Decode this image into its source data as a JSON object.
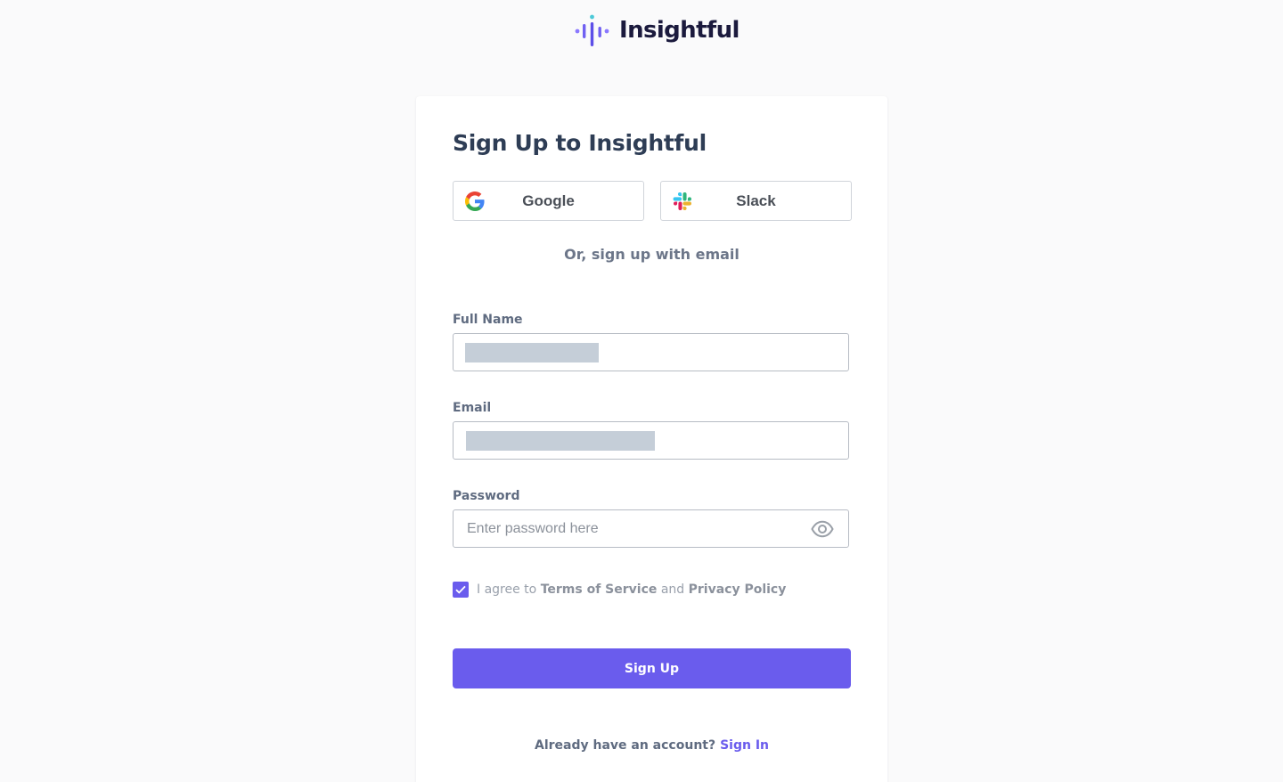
{
  "brand": {
    "name": "Insightful",
    "accent": "#6a5ced",
    "logo_icon": "audio-wave-logo"
  },
  "signup": {
    "title": "Sign Up to Insightful",
    "social": [
      {
        "label": "Google",
        "icon": "google-icon"
      },
      {
        "label": "Slack",
        "icon": "slack-icon"
      }
    ],
    "divider": "Or, sign up with email",
    "full_name": {
      "label": "Full Name",
      "value_redacted": true
    },
    "email": {
      "label": "Email",
      "value_redacted": true
    },
    "password": {
      "label": "Password",
      "placeholder": "Enter password here",
      "icon": "eye-icon"
    },
    "agree": {
      "checked": true,
      "prefix": "I agree to",
      "terms": "Terms of Service",
      "and": "and",
      "privacy": "Privacy Policy"
    },
    "submit_label": "Sign Up",
    "footer": {
      "question": "Already have an account?",
      "link": "Sign In"
    }
  }
}
